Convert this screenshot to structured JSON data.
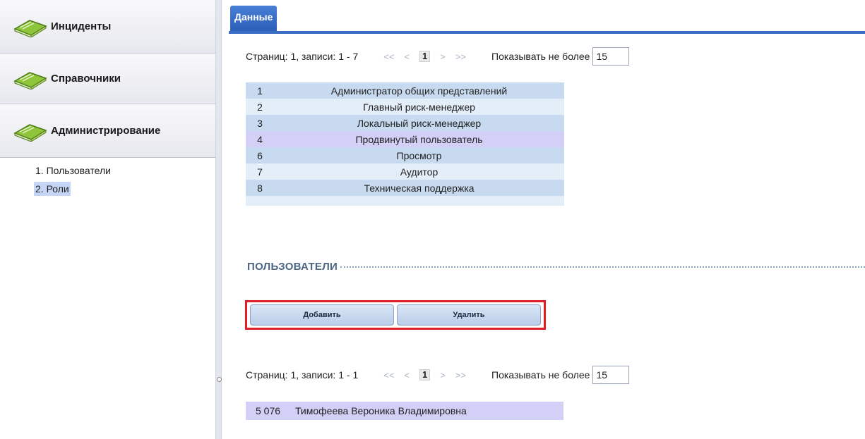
{
  "sidebar": {
    "sections": [
      {
        "label": "Инциденты"
      },
      {
        "label": "Справочники"
      },
      {
        "label": "Администрирование"
      }
    ],
    "submenu": [
      {
        "label": "1. Пользователи"
      },
      {
        "label": "2. Роли",
        "selected": true
      }
    ]
  },
  "tab": {
    "label": "Данные"
  },
  "roles_pager": {
    "summary": "Страниц: 1, записи: 1 - 7",
    "first": "<<",
    "prev": "<",
    "page": "1",
    "next": ">",
    "last": ">>",
    "show_label": "Показывать не более",
    "page_size": "15"
  },
  "roles": [
    {
      "id": "1",
      "name": "Администратор общих представлений"
    },
    {
      "id": "2",
      "name": "Главный риск-менеджер"
    },
    {
      "id": "3",
      "name": "Локальный риск-менеджер"
    },
    {
      "id": "4",
      "name": "Продвинутый пользователь",
      "selected": true
    },
    {
      "id": "6",
      "name": "Просмотр"
    },
    {
      "id": "7",
      "name": "Аудитор"
    },
    {
      "id": "8",
      "name": "Техническая поддержка"
    }
  ],
  "users_section": {
    "title": "ПОЛЬЗОВАТЕЛИ"
  },
  "buttons": {
    "add": "Добавить",
    "delete": "Удалить"
  },
  "users_pager": {
    "summary": "Страниц: 1, записи: 1 - 1",
    "first": "<<",
    "prev": "<",
    "page": "1",
    "next": ">",
    "last": ">>",
    "show_label": "Показывать не более",
    "page_size": "15"
  },
  "users": [
    {
      "id": "5 076",
      "name": "Тимофеева Вероника Владимировна"
    }
  ],
  "colors": {
    "accent": "#3a6ec4",
    "highlight_border": "#e01e26",
    "selected_row": "#d2d0f7"
  },
  "icons": {
    "section": "book-icon",
    "splitter": "collapse-handle-icon"
  }
}
